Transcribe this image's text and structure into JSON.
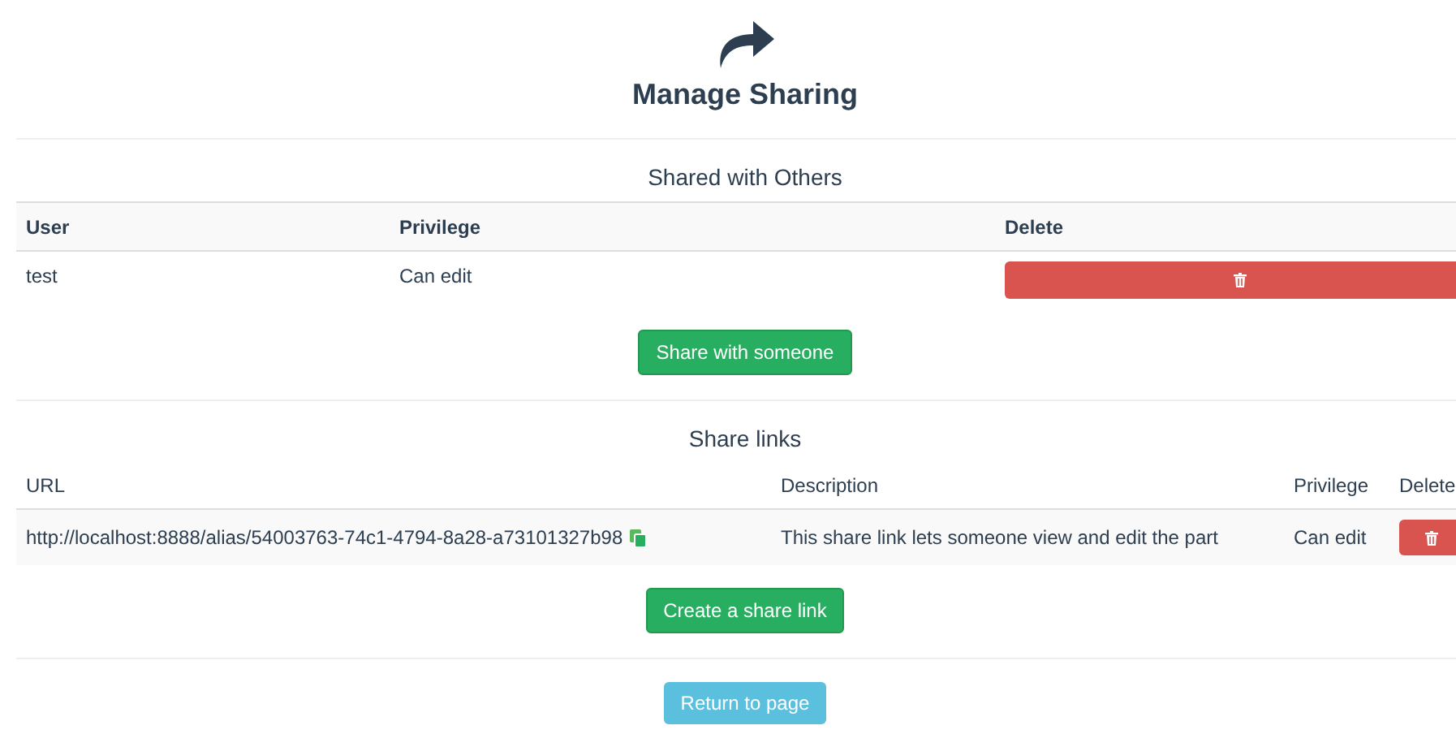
{
  "title": "Manage Sharing",
  "shared": {
    "heading": "Shared with Others",
    "columns": [
      "User",
      "Privilege",
      "Delete"
    ],
    "rows": [
      {
        "user": "test",
        "privilege": "Can edit"
      }
    ],
    "button": "Share with someone"
  },
  "links": {
    "heading": "Share links",
    "columns": [
      "URL",
      "Description",
      "Privilege",
      "Delete"
    ],
    "rows": [
      {
        "url": "http://localhost:8888/alias/54003763-74c1-4794-8a28-a73101327b98",
        "description": "This share link lets someone view and edit the part",
        "privilege": "Can edit"
      }
    ],
    "button": "Create a share link"
  },
  "return_button": "Return to page"
}
